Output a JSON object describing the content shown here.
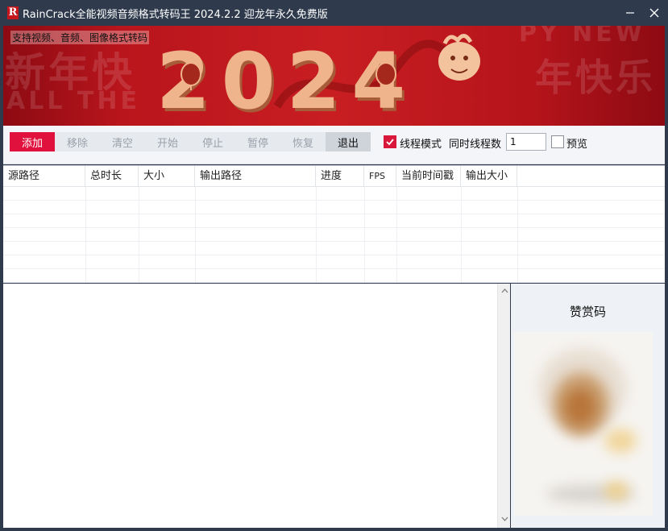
{
  "window": {
    "title": "RainCrack全能视频音频格式转码王 2024.2.2 迎龙年永久免费版",
    "app_icon_glyph": "R",
    "minimize_icon": "minimize-icon",
    "close_icon": "close-icon"
  },
  "banner": {
    "caption": "支持视频、音频、图像格式转码",
    "year": "2024",
    "bg_text_1": "新年快",
    "bg_text_2": "ALL THE",
    "bg_text_3": "年快乐",
    "bg_text_4": "PY NEW"
  },
  "toolbar": {
    "add": "添加",
    "remove": "移除",
    "clear": "清空",
    "start": "开始",
    "stop": "停止",
    "pause": "暂停",
    "resume": "恢复",
    "exit": "退出",
    "thread_mode_label": "线程模式",
    "thread_mode_checked": true,
    "concurrent_label": "同时线程数",
    "concurrent_value": "1",
    "preview_label": "预览",
    "preview_checked": false
  },
  "table": {
    "columns": [
      "源路径",
      "总时长",
      "大小",
      "输出路径",
      "进度",
      "FPS",
      "当前时间戳",
      "输出大小"
    ],
    "rows": []
  },
  "donate": {
    "title": "赞赏码"
  },
  "colors": {
    "accent": "#e0113c",
    "titlebar": "#2f3b4c",
    "banner_red": "#c81e22",
    "year_gold": "#f0b48c"
  }
}
